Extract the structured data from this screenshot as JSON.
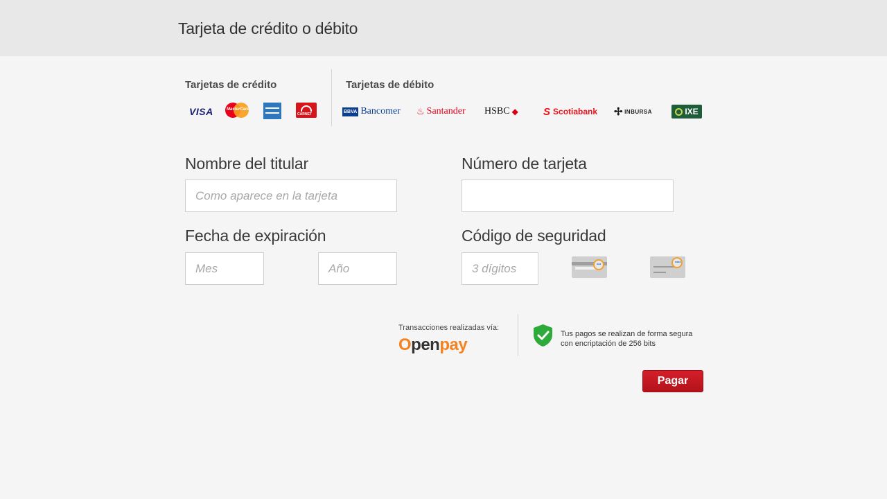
{
  "header": {
    "title": "Tarjeta de crédito o débito"
  },
  "cards": {
    "credit_label": "Tarjetas de crédito",
    "debit_label": "Tarjetas de débito",
    "credit_logos": {
      "visa": "VISA",
      "mastercard": "MasterCard",
      "amex": "American Express",
      "carnet": "CARNET"
    },
    "debit_logos": {
      "bancomer_box": "BBVA",
      "bancomer": "Bancomer",
      "santander": "Santander",
      "hsbc": "HSBC",
      "scotiabank": "Scotiabank",
      "inbursa": "INBURSA",
      "ixe": "IXE"
    }
  },
  "form": {
    "holder_label": "Nombre del titular",
    "holder_placeholder": "Como aparece en la tarjeta",
    "holder_value": "",
    "number_label": "Número de tarjeta",
    "number_placeholder": "",
    "number_value": "",
    "expiry_label": "Fecha de expiración",
    "month_placeholder": "Mes",
    "year_placeholder": "Año",
    "cvv_label": "Código de seguridad",
    "cvv_placeholder": "3 dígitos"
  },
  "footer": {
    "openpay_caption": "Transacciones realizadas vía:",
    "openpay_brand": "Openpay",
    "secure_line1": "Tus pagos se realizan de forma segura",
    "secure_line2": "con encriptación de 256 bits",
    "pay_label": "Pagar"
  },
  "colors": {
    "accent": "#c4161f",
    "openpay": "#f58220",
    "shield": "#2eaa3a"
  }
}
